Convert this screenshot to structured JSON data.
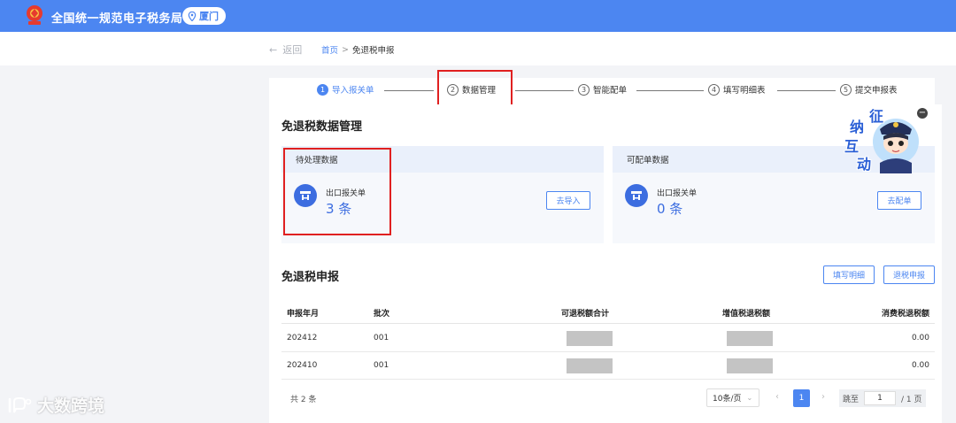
{
  "header": {
    "app_title": "全国统一规范电子税务局",
    "city": "厦门"
  },
  "nav": {
    "back_label": "返回",
    "breadcrumb_home": "首页",
    "breadcrumb_sep": ">",
    "breadcrumb_current": "免退税申报"
  },
  "steps": [
    {
      "num": "1",
      "label": "导入报关单",
      "active": true
    },
    {
      "num": "2",
      "label": "数据管理",
      "active": false
    },
    {
      "num": "3",
      "label": "智能配单",
      "active": false
    },
    {
      "num": "4",
      "label": "填写明细表",
      "active": false
    },
    {
      "num": "5",
      "label": "提交申报表",
      "active": false
    }
  ],
  "data_mgmt": {
    "title": "免退税数据管理",
    "pending": {
      "header": "待处理数据",
      "label": "出口报关单",
      "count": "3 条",
      "button": "去导入"
    },
    "matchable": {
      "header": "可配单数据",
      "label": "出口报关单",
      "count": "0 条",
      "button": "去配单"
    }
  },
  "mascot": {
    "chars": [
      "征",
      "纳",
      "互",
      "动"
    ],
    "close": "−"
  },
  "declaration": {
    "title": "免退税申报",
    "btn_fill": "填写明细",
    "btn_refund": "退税申报",
    "columns": [
      "申报年月",
      "批次",
      "可退税额合计",
      "增值税退税额",
      "消费税退税额"
    ],
    "rows": [
      {
        "period": "202412",
        "batch": "001",
        "consumption_tax": "0.00"
      },
      {
        "period": "202410",
        "batch": "001",
        "consumption_tax": "0.00"
      }
    ]
  },
  "pagination": {
    "total": "共 2 条",
    "page_size": "10条/页",
    "current_page": "1",
    "jump_label": "跳至",
    "jump_value": "1",
    "page_total": "/ 1 页"
  },
  "watermark": "大数跨境",
  "colors": {
    "primary": "#4c86f1",
    "highlight": "#e02020"
  }
}
